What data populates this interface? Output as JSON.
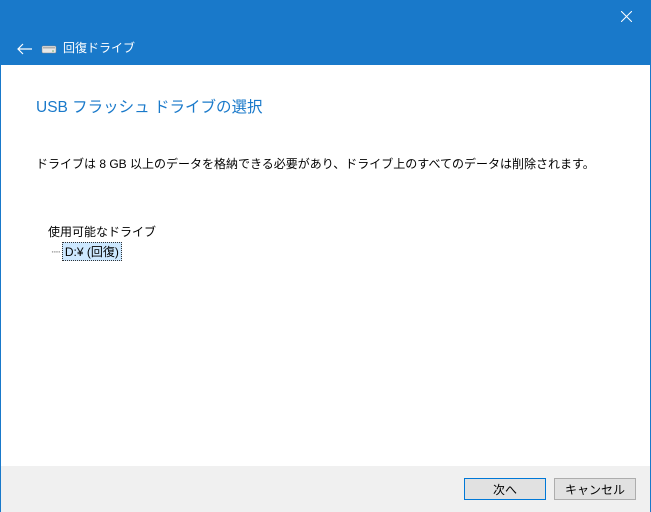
{
  "titlebar": {
    "title": "回復ドライブ"
  },
  "content": {
    "heading": "USB フラッシュ ドライブの選択",
    "description": "ドライブは 8 GB 以上のデータを格納できる必要があり、ドライブ上のすべてのデータは削除されます。",
    "drives_label": "使用可能なドライブ",
    "drives": [
      {
        "label": "D:¥ (回復)"
      }
    ]
  },
  "footer": {
    "next_label": "次へ",
    "cancel_label": "キャンセル"
  }
}
